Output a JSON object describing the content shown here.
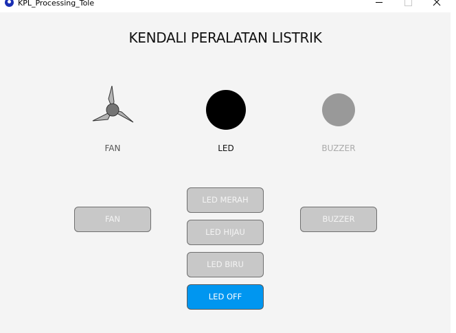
{
  "window": {
    "title": "KPL_Processing_Tole"
  },
  "heading": "KENDALI PERALATAN LISTRIK",
  "devices": {
    "fan": {
      "label": "FAN",
      "icon": "fan-icon"
    },
    "led": {
      "label": "LED",
      "indicator_color": "#000000"
    },
    "buzzer": {
      "label": "BUZZER",
      "indicator_color": "#999999"
    }
  },
  "buttons": {
    "fan": "FAN",
    "buzzer": "BUZZER",
    "led_red": "LED MERAH",
    "led_green": "LED HIJAU",
    "led_blue": "LED BIRU",
    "led_off": "LED OFF"
  },
  "colors": {
    "active_button": "#0096f0",
    "inactive_button": "#c8c8c8"
  }
}
